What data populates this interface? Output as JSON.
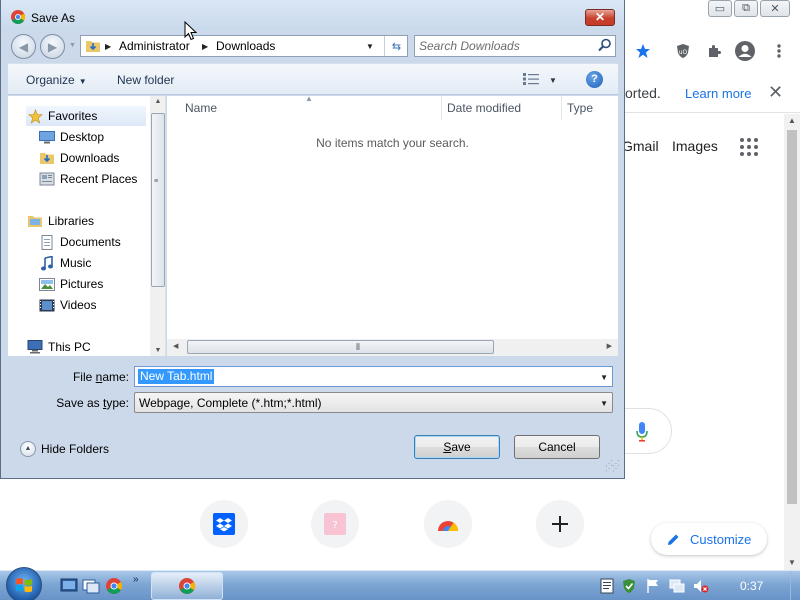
{
  "chrome": {
    "infobar": {
      "message_tail": "orted.",
      "learn_more": "Learn more",
      "close": "✕"
    },
    "ntp_links": {
      "gmail": "Gmail",
      "images": "Images"
    },
    "customize_label": "Customize",
    "window_controls": {
      "minimize": "▭",
      "restore": "⧉",
      "close": "✕"
    },
    "colors": {
      "accent": "#1a73e8"
    }
  },
  "dialog": {
    "title": "Save As",
    "close_label": "✕",
    "breadcrumbs": [
      "Administrator",
      "Downloads"
    ],
    "search": {
      "placeholder": "Search Downloads"
    },
    "toolbar": {
      "organize": "Organize",
      "new_folder": "New folder",
      "help": "?"
    },
    "nav_pane": {
      "items": [
        {
          "label": "Favorites",
          "icon": "star-icon"
        },
        {
          "label": "Desktop",
          "icon": "desktop-icon"
        },
        {
          "label": "Downloads",
          "icon": "downloads-folder-icon"
        },
        {
          "label": "Recent Places",
          "icon": "recent-places-icon"
        },
        {
          "label": "Libraries",
          "icon": "libraries-icon"
        },
        {
          "label": "Documents",
          "icon": "documents-icon"
        },
        {
          "label": "Music",
          "icon": "music-icon"
        },
        {
          "label": "Pictures",
          "icon": "pictures-icon"
        },
        {
          "label": "Videos",
          "icon": "videos-icon"
        },
        {
          "label": "This PC",
          "icon": "computer-icon"
        }
      ]
    },
    "file_list": {
      "columns": [
        "Name",
        "Date modified",
        "Type"
      ],
      "empty_message": "No items match your search."
    },
    "file_name": {
      "label_prefix": "File ",
      "label_key": "n",
      "label_suffix": "ame:",
      "value": "New Tab.html"
    },
    "save_type": {
      "label_prefix": "Save as ",
      "label_key": "t",
      "label_suffix": "ype:",
      "value": "Webpage, Complete (*.htm;*.html)"
    },
    "hide_folders": "Hide Folders",
    "buttons": {
      "save_key": "S",
      "save_rest": "ave",
      "cancel": "Cancel"
    }
  },
  "taskbar": {
    "clock": "0:37",
    "more": "»"
  }
}
